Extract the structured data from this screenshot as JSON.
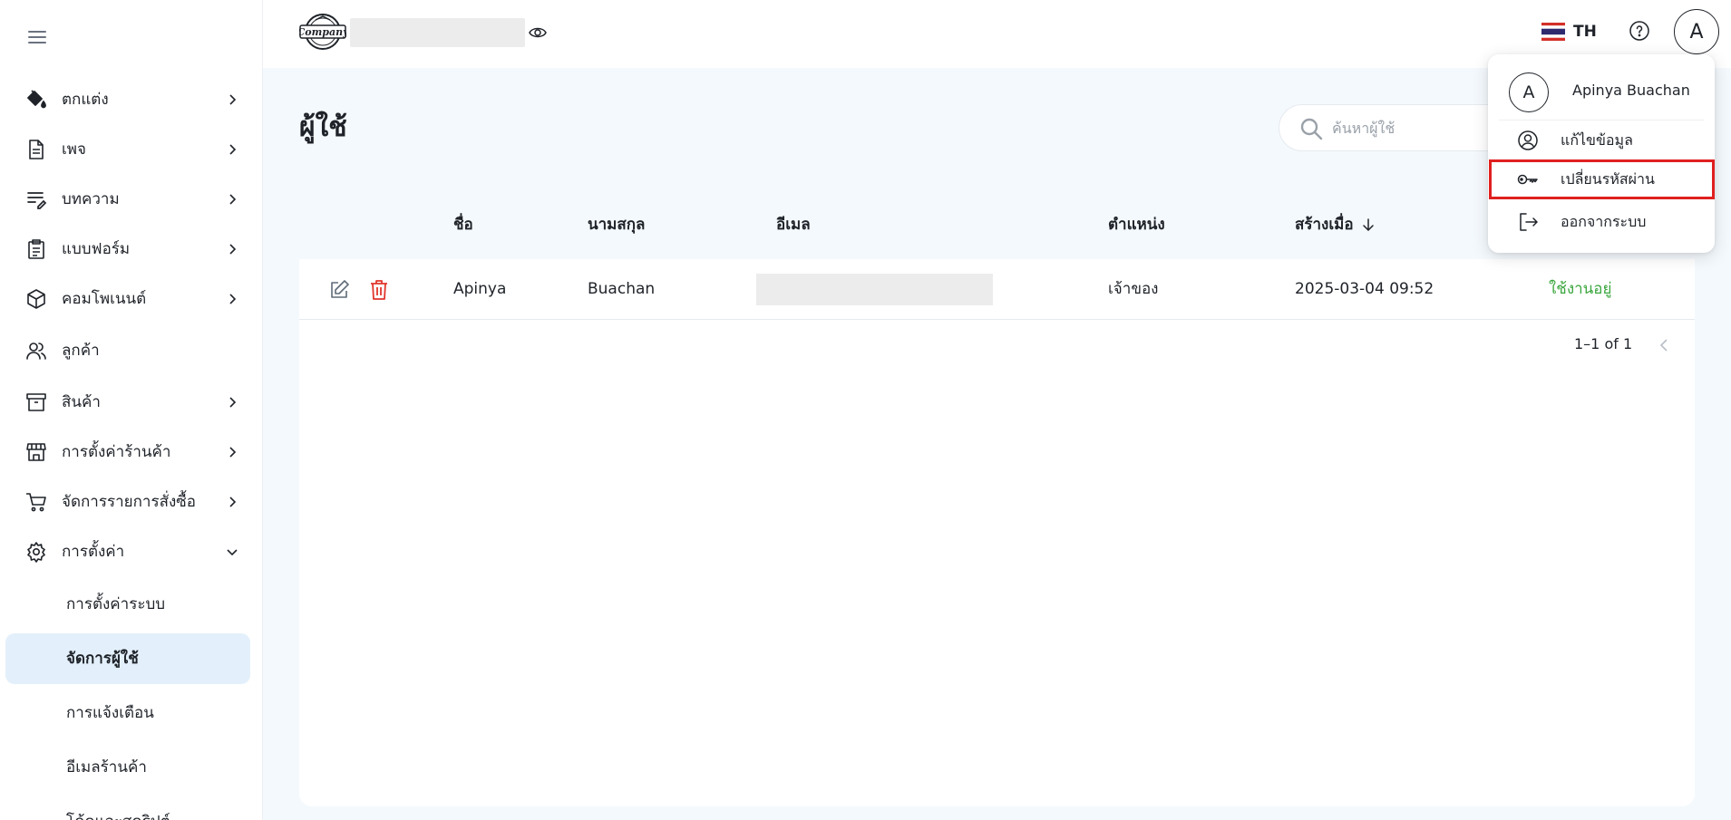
{
  "sidebar": {
    "items": [
      {
        "label": "ตกแต่ง",
        "icon": "paint-bucket-icon"
      },
      {
        "label": "เพจ",
        "icon": "page-icon"
      },
      {
        "label": "บทความ",
        "icon": "article-icon"
      },
      {
        "label": "แบบฟอร์ม",
        "icon": "clipboard-icon"
      },
      {
        "label": "คอมโพเนนต์",
        "icon": "cube-icon"
      },
      {
        "label": "ลูกค้า",
        "icon": "customers-icon"
      },
      {
        "label": "สินค้า",
        "icon": "archive-icon"
      },
      {
        "label": "การตั้งค่าร้านค้า",
        "icon": "store-icon"
      },
      {
        "label": "จัดการรายการสั่งซื้อ",
        "icon": "cart-icon"
      },
      {
        "label": "การตั้งค่า",
        "icon": "gear-icon"
      }
    ],
    "subitems": [
      {
        "label": "การตั้งค่าระบบ"
      },
      {
        "label": "จัดการผู้ใช้",
        "active": true
      },
      {
        "label": "การแจ้งเตือน"
      },
      {
        "label": "อีเมลร้านค้า"
      },
      {
        "label": "โค้ดและสคริปต์"
      }
    ]
  },
  "header": {
    "logo_text": "Company",
    "language": "TH",
    "avatar_initial": "A"
  },
  "main": {
    "title": "ผู้ใช้",
    "search_placeholder": "ค้นหาผู้ใช้"
  },
  "table": {
    "columns": {
      "first_name": "ชื่อ",
      "last_name": "นามสกุล",
      "email": "อีเมล",
      "position": "ตำแหน่ง",
      "created": "สร้างเมื่อ"
    },
    "rows": [
      {
        "first_name": "Apinya",
        "last_name": "Buachan",
        "position": "เจ้าของ",
        "created": "2025-03-04 09:52",
        "status": "ใช้งานอยู่"
      }
    ],
    "pagination": "1–1 of 1"
  },
  "dropdown": {
    "avatar_initial": "A",
    "name": "Apinya Buachan",
    "items": [
      {
        "label": "แก้ไขข้อมูล",
        "icon": "user-circle-icon"
      },
      {
        "label": "เปลี่ยนรหัสผ่าน",
        "icon": "key-icon"
      },
      {
        "label": "ออกจากระบบ",
        "icon": "logout-icon"
      }
    ]
  },
  "colors": {
    "main_bg": "#f4f9fd",
    "active_nav_bg": "#e3f0fb",
    "status_active": "#3aa63d",
    "delete_red": "#e0362b",
    "highlight_border": "#e02020"
  }
}
